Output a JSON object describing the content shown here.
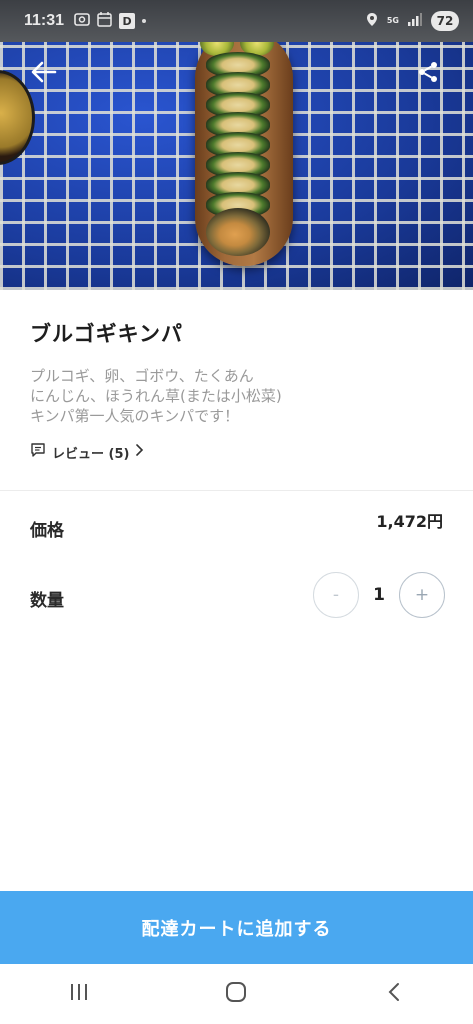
{
  "status_bar": {
    "time": "11:31",
    "app_badge": "D",
    "network": "5G",
    "battery": "72"
  },
  "product": {
    "name": "ブルゴギキンパ",
    "description_lines": [
      "プルコギ、卵、ゴボウ、たくあん",
      "にんじん、ほうれん草(または小松菜)",
      "キンパ第一人気のキンパです！"
    ],
    "review_label": "レビュー (5)"
  },
  "price": {
    "label": "価格",
    "value": "1,472円"
  },
  "quantity": {
    "label": "数量",
    "value": "1",
    "minus": "-",
    "plus": "+"
  },
  "cart_button": {
    "label": "配達カートに追加する"
  },
  "colors": {
    "accent": "#4aa8f0",
    "text": "#222222",
    "muted": "#9a9a9a"
  }
}
